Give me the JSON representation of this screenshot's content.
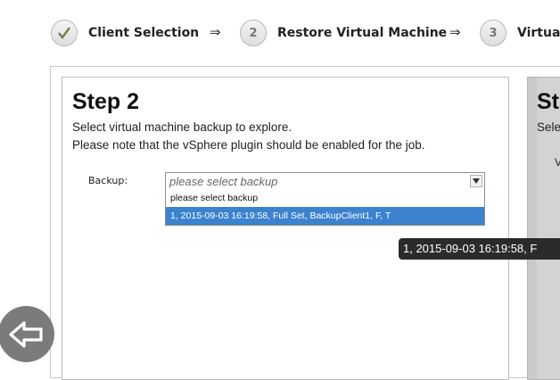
{
  "wizard": {
    "steps": [
      {
        "number": "",
        "label": "Client Selection",
        "state": "completed",
        "icon": "checkmark-icon"
      },
      {
        "number": "2",
        "label": "Restore Virtual Machine",
        "state": "current"
      },
      {
        "number": "3",
        "label": "Virtual",
        "state": "pending"
      }
    ],
    "separator": "⇒"
  },
  "step_panel": {
    "title": "Step 2",
    "line1": "Select virtual machine backup to explore.",
    "line2": "Please note that the vSphere plugin should be enabled for the job.",
    "backup_label": "Backup:",
    "backup_select": {
      "placeholder": "please select backup",
      "options": [
        {
          "label": "please select backup",
          "selected": false
        },
        {
          "label": "1, 2015-09-03 16:19:58, Full Set, BackupClient1, F, T",
          "selected": true
        }
      ]
    }
  },
  "next_panel": {
    "title": "St",
    "desc": "Sele",
    "label": "V"
  },
  "tooltip": {
    "text": "1, 2015-09-03 16:19:58, F"
  },
  "back_button": {
    "icon": "back-arrow-icon"
  },
  "colors": {
    "selection": "#3b82cf",
    "tooltip_bg": "#2b2b2b",
    "next_panel_bg": "#d3d3d3",
    "back_button_bg": "#7b7b7b"
  }
}
